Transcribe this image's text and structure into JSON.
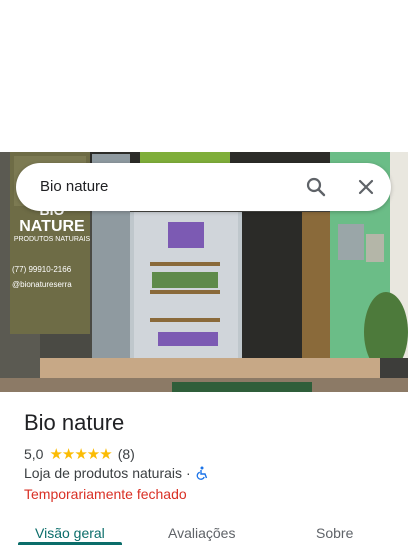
{
  "search": {
    "query": "Bio nature"
  },
  "icons": {
    "search": "search-icon",
    "close": "close-icon",
    "accessibility": "wheelchair-icon",
    "star": "star-icon"
  },
  "photo": {
    "sign_brand_line1": "BIO",
    "sign_brand_line2": "NATURE",
    "sign_subtitle": "PRODUTOS NATURAIS",
    "sign_phone": "(77) 99910-2166",
    "sign_instagram": "@bionatureserra"
  },
  "place": {
    "name": "Bio nature",
    "rating": "5,0",
    "stars": "★★★★★",
    "review_count": "(8)",
    "category": "Loja de produtos naturais",
    "separator": "·",
    "status": "Temporariamente fechado"
  },
  "tabs": [
    {
      "label": "Visão geral",
      "active": true
    },
    {
      "label": "Avaliações",
      "active": false
    },
    {
      "label": "Sobre",
      "active": false
    }
  ],
  "colors": {
    "accent": "#0b6d6a",
    "closed": "#d93025",
    "star": "#fbbc04"
  }
}
